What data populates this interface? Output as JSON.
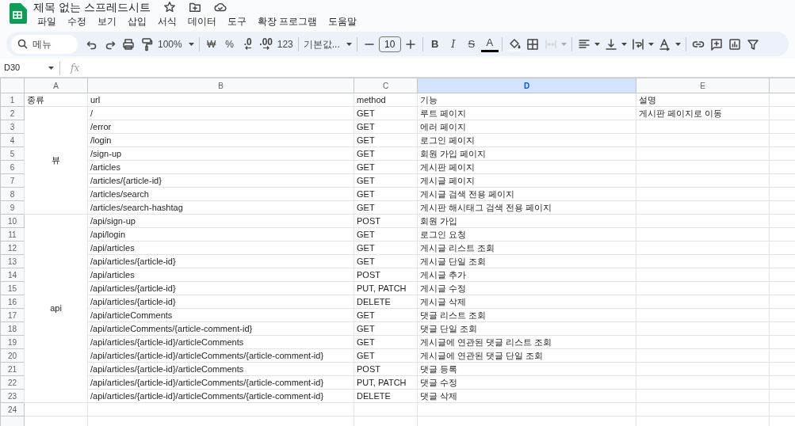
{
  "app": {
    "title": "제목 없는 스프레드시트",
    "menu": [
      "파일",
      "수정",
      "보기",
      "삽입",
      "서식",
      "데이터",
      "도구",
      "확장 프로그램",
      "도움말"
    ]
  },
  "toolbar": [
    {
      "kind": "search",
      "label": "메뉴",
      "disabled": false
    },
    {
      "kind": "undo",
      "disabled": false
    },
    {
      "kind": "redo",
      "disabled": false
    },
    {
      "kind": "print",
      "disabled": false
    },
    {
      "kind": "paint",
      "disabled": false
    },
    {
      "kind": "dropdown",
      "label": "100%",
      "disabled": false
    },
    {
      "kind": "sep"
    },
    {
      "kind": "text",
      "label": "₩",
      "disabled": false
    },
    {
      "kind": "text",
      "label": "%",
      "disabled": false
    },
    {
      "kind": "decrease",
      "label": ".0",
      "disabled": false
    },
    {
      "kind": "increase",
      "label": ".00",
      "disabled": false
    },
    {
      "kind": "text",
      "label": "123",
      "disabled": false
    },
    {
      "kind": "sep"
    },
    {
      "kind": "dropdown",
      "label": "기본값...",
      "disabled": false
    },
    {
      "kind": "sep"
    },
    {
      "kind": "minus",
      "disabled": false
    },
    {
      "kind": "input",
      "label": "10",
      "disabled": false
    },
    {
      "kind": "plus",
      "disabled": false
    },
    {
      "kind": "sep"
    },
    {
      "kind": "bold",
      "label": "B",
      "disabled": false
    },
    {
      "kind": "italic",
      "label": "I",
      "disabled": false
    },
    {
      "kind": "strike",
      "label": "S",
      "disabled": false
    },
    {
      "kind": "textcolor",
      "label": "A",
      "disabled": false
    },
    {
      "kind": "sep"
    },
    {
      "kind": "fill",
      "disabled": false
    },
    {
      "kind": "borders",
      "disabled": false
    },
    {
      "kind": "merge",
      "disabled": true
    },
    {
      "kind": "sep"
    },
    {
      "kind": "halign",
      "disabled": false
    },
    {
      "kind": "valign",
      "disabled": false
    },
    {
      "kind": "wrap",
      "disabled": false
    },
    {
      "kind": "rotate",
      "disabled": false
    },
    {
      "kind": "sep"
    },
    {
      "kind": "link",
      "disabled": false
    },
    {
      "kind": "comment",
      "disabled": false
    },
    {
      "kind": "chart",
      "disabled": false
    },
    {
      "kind": "filter",
      "disabled": false
    }
  ],
  "formula_bar": {
    "name_box": "D30",
    "fx": "fx"
  },
  "sheet": {
    "columns": [
      {
        "label": "A",
        "selected": false
      },
      {
        "label": "B",
        "selected": false
      },
      {
        "label": "C",
        "selected": false
      },
      {
        "label": "D",
        "selected": true
      },
      {
        "label": "E",
        "selected": false
      }
    ],
    "header_row": {
      "number": "1",
      "cells": [
        "종류",
        "url",
        "method",
        "기능",
        "설명"
      ]
    },
    "groups": [
      {
        "category": "뷰",
        "rows": [
          {
            "number": "2",
            "url": "/",
            "method": "GET",
            "function": "루트 페이지",
            "description": "게시판 페이지로 이동"
          },
          {
            "number": "3",
            "url": "/error",
            "method": "GET",
            "function": "에러 페이지"
          },
          {
            "number": "4",
            "url": "/login",
            "method": "GET",
            "function": "로그인 페이지"
          },
          {
            "number": "5",
            "url": "/sign-up",
            "method": "GET",
            "function": "회원 가입 페이지"
          },
          {
            "number": "6",
            "url": "/articles",
            "method": "GET",
            "function": "게시판 페이지"
          },
          {
            "number": "7",
            "url": "/articles/{article-id}",
            "method": "GET",
            "function": "게시글 페이지"
          },
          {
            "number": "8",
            "url": "/articles/search",
            "method": "GET",
            "function": "게시글 검색 전용 페이지"
          },
          {
            "number": "9",
            "url": "/articles/search-hashtag",
            "method": "GET",
            "function": "게시판 해시태그 검색 전용 페이지"
          }
        ]
      },
      {
        "category": "api",
        "rows": [
          {
            "number": "10",
            "url": "/api/sign-up",
            "method": "POST",
            "function": "회원 가입"
          },
          {
            "number": "11",
            "url": "/api/login",
            "method": "GET",
            "function": "로그인 요청"
          },
          {
            "number": "12",
            "url": "/api/articles",
            "method": "GET",
            "function": "게시글 리스트 조회"
          },
          {
            "number": "13",
            "url": "/api/articles/{article-id}",
            "method": "GET",
            "function": "게시글 단일 조회"
          },
          {
            "number": "14",
            "url": "/api/articles",
            "method": "POST",
            "function": "게시글 추가"
          },
          {
            "number": "15",
            "url": "/api/articles/{article-id}",
            "method": "PUT, PATCH",
            "function": "게시글 수정"
          },
          {
            "number": "16",
            "url": "/api/articles/{article-id}",
            "method": "DELETE",
            "function": "게시글 삭제"
          },
          {
            "number": "17",
            "url": "/api/articleComments",
            "method": "GET",
            "function": "댓글 리스트 조회"
          },
          {
            "number": "18",
            "url": "/api/articleComments/{article-comment-id}",
            "method": "GET",
            "function": "댓글 단일 조회"
          },
          {
            "number": "19",
            "url": "/api/articles/{article-id}/articleComments",
            "method": "GET",
            "function": "게시글에 연관된 댓글 리스트 조회"
          },
          {
            "number": "20",
            "url": "/api/articles/{article-id}/articleComments/{article-comment-id}",
            "method": "GET",
            "function": "게시글에 연관된 댓글 단일 조회"
          },
          {
            "number": "21",
            "url": "/api/articles/{article-id}/articleComments",
            "method": "POST",
            "function": "댓글 등록"
          },
          {
            "number": "22",
            "url": "/api/articles/{article-id}/articleComments/{article-comment-id}",
            "method": "PUT, PATCH",
            "function": "댓글 수정"
          },
          {
            "number": "23",
            "url": "/api/articles/{article-id}/articleComments/{article-comment-id}",
            "method": "DELETE",
            "function": "댓글 삭제"
          }
        ]
      }
    ],
    "empty_rows": [
      "24"
    ]
  }
}
